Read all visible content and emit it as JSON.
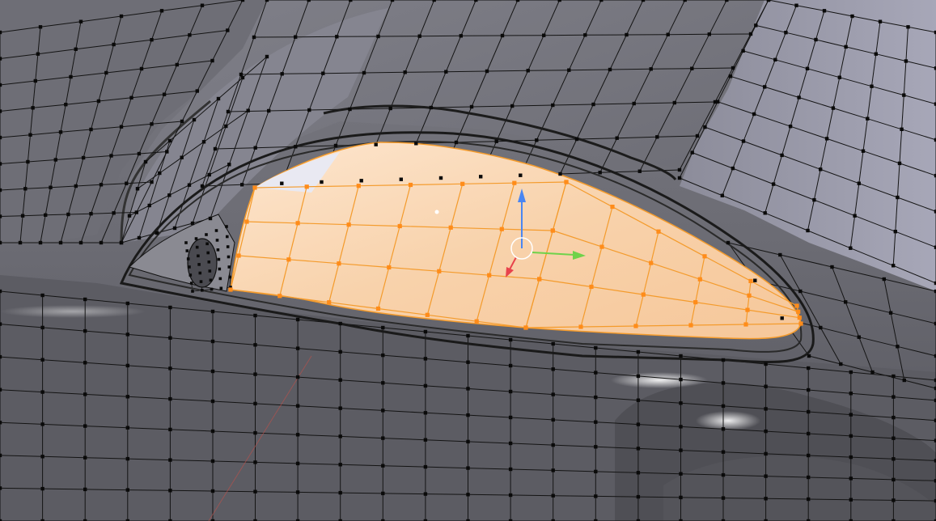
{
  "viewport": {
    "mode": "edit-mesh",
    "colors": {
      "background": "#5a5a60",
      "surface_dark": "#5f5f66",
      "surface_mid": "#77777f",
      "surface_light": "#8f8f99",
      "roof_panel": "#9d9dae",
      "wire": "#141414",
      "vertex": "#0a0a0a",
      "selected_face": "#f7cfa4",
      "selected_face_light": "#fbe3c9",
      "selected_edge": "#f49b2c",
      "selected_vertex": "#ff8c1a",
      "outline": "#1c1c1c",
      "specular": "#e8e8ee",
      "gizmo_x": "#e8434c",
      "gizmo_y": "#6fd24a",
      "gizmo_z": "#4a86f2",
      "pivot": "#ffffff",
      "red_axis_line": "#c0504a"
    },
    "selection": {
      "object": "side-window",
      "selected": true
    },
    "gizmo": {
      "axes": [
        "x",
        "y",
        "z"
      ],
      "icon": "translate-manipulator-icon"
    }
  }
}
